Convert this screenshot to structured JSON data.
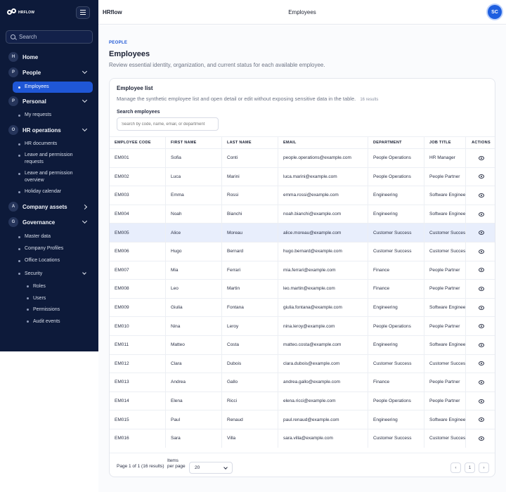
{
  "sidebar": {
    "logo_text": "HRFLOW",
    "search_placeholder": "Search",
    "nav": {
      "home": {
        "badge": "H",
        "label": "Home"
      },
      "people": {
        "badge": "P",
        "label": "People",
        "children": [
          "Employees"
        ]
      },
      "personal": {
        "badge": "P",
        "label": "Personal",
        "children": [
          "My requests"
        ]
      },
      "hr_operations": {
        "badge": "O",
        "label": "HR operations",
        "children": [
          "HR documents",
          "Leave and permission requests",
          "Leave and permission overview",
          "Holiday calendar"
        ]
      },
      "company_assets": {
        "badge": "A",
        "label": "Company assets"
      },
      "governance": {
        "badge": "G",
        "label": "Governance",
        "children": [
          "Master data",
          "Company Profiles",
          "Office Locations"
        ],
        "security": {
          "label": "Security",
          "children": [
            "Roles",
            "Users",
            "Permissions",
            "Audit events"
          ]
        }
      }
    }
  },
  "topbar": {
    "brand": "HRflow",
    "page_name": "Employees",
    "avatar_initials": "SC"
  },
  "header": {
    "eyebrow": "PEOPLE",
    "title": "Employees",
    "subtitle": "Review essential identity, organization, and current status for each available employee."
  },
  "card": {
    "title": "Employee list",
    "description": "Manage the synthetic employee list and open detail or edit without exposing sensitive data in the table.",
    "result_count": "16 results",
    "search_label": "Search employees",
    "search_placeholder": "Search by code, name, email, or department"
  },
  "table": {
    "columns": [
      "EMPLOYEE CODE",
      "FIRST NAME",
      "LAST NAME",
      "EMAIL",
      "DEPARTMENT",
      "JOB TITLE",
      "ACTIONS"
    ],
    "rows": [
      [
        "EM001",
        "Sofia",
        "Conti",
        "people.operations@example.com",
        "People Operations",
        "HR Manager"
      ],
      [
        "EM002",
        "Luca",
        "Marini",
        "luca.marini@example.com",
        "People Operations",
        "People Partner"
      ],
      [
        "EM003",
        "Emma",
        "Rossi",
        "emma.rossi@example.com",
        "Engineering",
        "Software Engineer"
      ],
      [
        "EM004",
        "Noah",
        "Bianchi",
        "noah.bianchi@example.com",
        "Engineering",
        "Software Engineer"
      ],
      [
        "EM005",
        "Alice",
        "Moreau",
        "alice.moreau@example.com",
        "Customer Success",
        "Customer Success"
      ],
      [
        "EM006",
        "Hugo",
        "Bernard",
        "hugo.bernard@example.com",
        "Customer Success",
        "Customer Success"
      ],
      [
        "EM007",
        "Mia",
        "Ferrari",
        "mia.ferrari@example.com",
        "Finance",
        "People Partner"
      ],
      [
        "EM008",
        "Leo",
        "Martin",
        "leo.martin@example.com",
        "Finance",
        "People Partner"
      ],
      [
        "EM009",
        "Giulia",
        "Fontana",
        "giulia.fontana@example.com",
        "Engineering",
        "Software Engineer"
      ],
      [
        "EM010",
        "Nina",
        "Leroy",
        "nina.leroy@example.com",
        "People Operations",
        "People Partner"
      ],
      [
        "EM011",
        "Matteo",
        "Costa",
        "matteo.costa@example.com",
        "Engineering",
        "Software Engineer"
      ],
      [
        "EM012",
        "Clara",
        "Dubois",
        "clara.dubois@example.com",
        "Customer Success",
        "Customer Success"
      ],
      [
        "EM013",
        "Andrea",
        "Gallo",
        "andrea.gallo@example.com",
        "Finance",
        "People Partner"
      ],
      [
        "EM014",
        "Elena",
        "Ricci",
        "elena.ricci@example.com",
        "People Operations",
        "People Partner"
      ],
      [
        "EM015",
        "Paul",
        "Renaud",
        "paul.renaud@example.com",
        "Engineering",
        "Software Engineer"
      ],
      [
        "EM016",
        "Sara",
        "Villa",
        "sara.villa@example.com",
        "Customer Success",
        "Customer Success"
      ]
    ],
    "highlighted_row": 4
  },
  "footer": {
    "page_info": "Page 1 of 1 (16 results)",
    "items_per_page_label": "Items per page",
    "items_per_page_value": "20",
    "prev_label": "‹",
    "page_label": "1",
    "next_label": "›"
  },
  "colors": {
    "sidebar_bg": "#0d1a3a",
    "accent": "#1f57d6",
    "highlight_row": "#e8eefc"
  }
}
